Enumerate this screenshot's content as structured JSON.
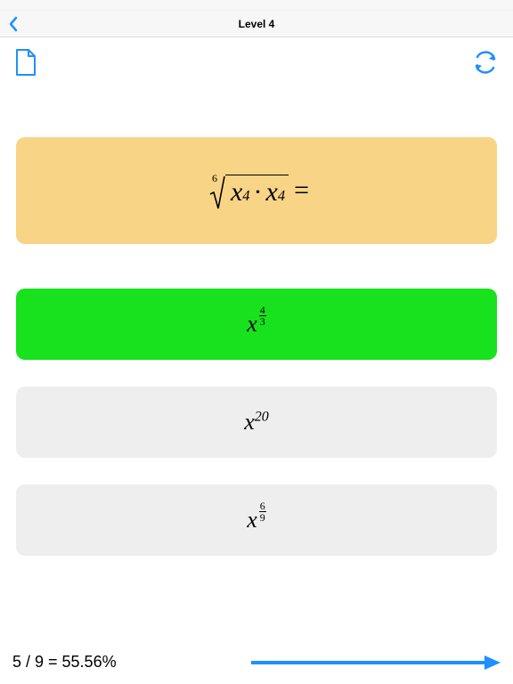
{
  "navbar": {
    "title": "Level 4"
  },
  "colors": {
    "accent": "#1e90ff",
    "questionBg": "#f8d486",
    "answerBg": "#eeeeef",
    "correctBg": "#18e21d"
  },
  "question": {
    "rootIndex": "6",
    "base1": "x",
    "exp1": "4",
    "op": "·",
    "base2": "x",
    "exp2": "4",
    "trail": "="
  },
  "answers": [
    {
      "base": "x",
      "expType": "frac",
      "num": "4",
      "den": "3",
      "state": "correct"
    },
    {
      "base": "x",
      "expType": "int",
      "exp": "20",
      "state": "normal"
    },
    {
      "base": "x",
      "expType": "frac",
      "num": "6",
      "den": "9",
      "state": "normal"
    }
  ],
  "score": {
    "text": "5 / 9 = 55.56%"
  },
  "icons": {
    "back": "back",
    "newfile": "new-file",
    "refresh": "refresh",
    "next": "next-arrow"
  }
}
